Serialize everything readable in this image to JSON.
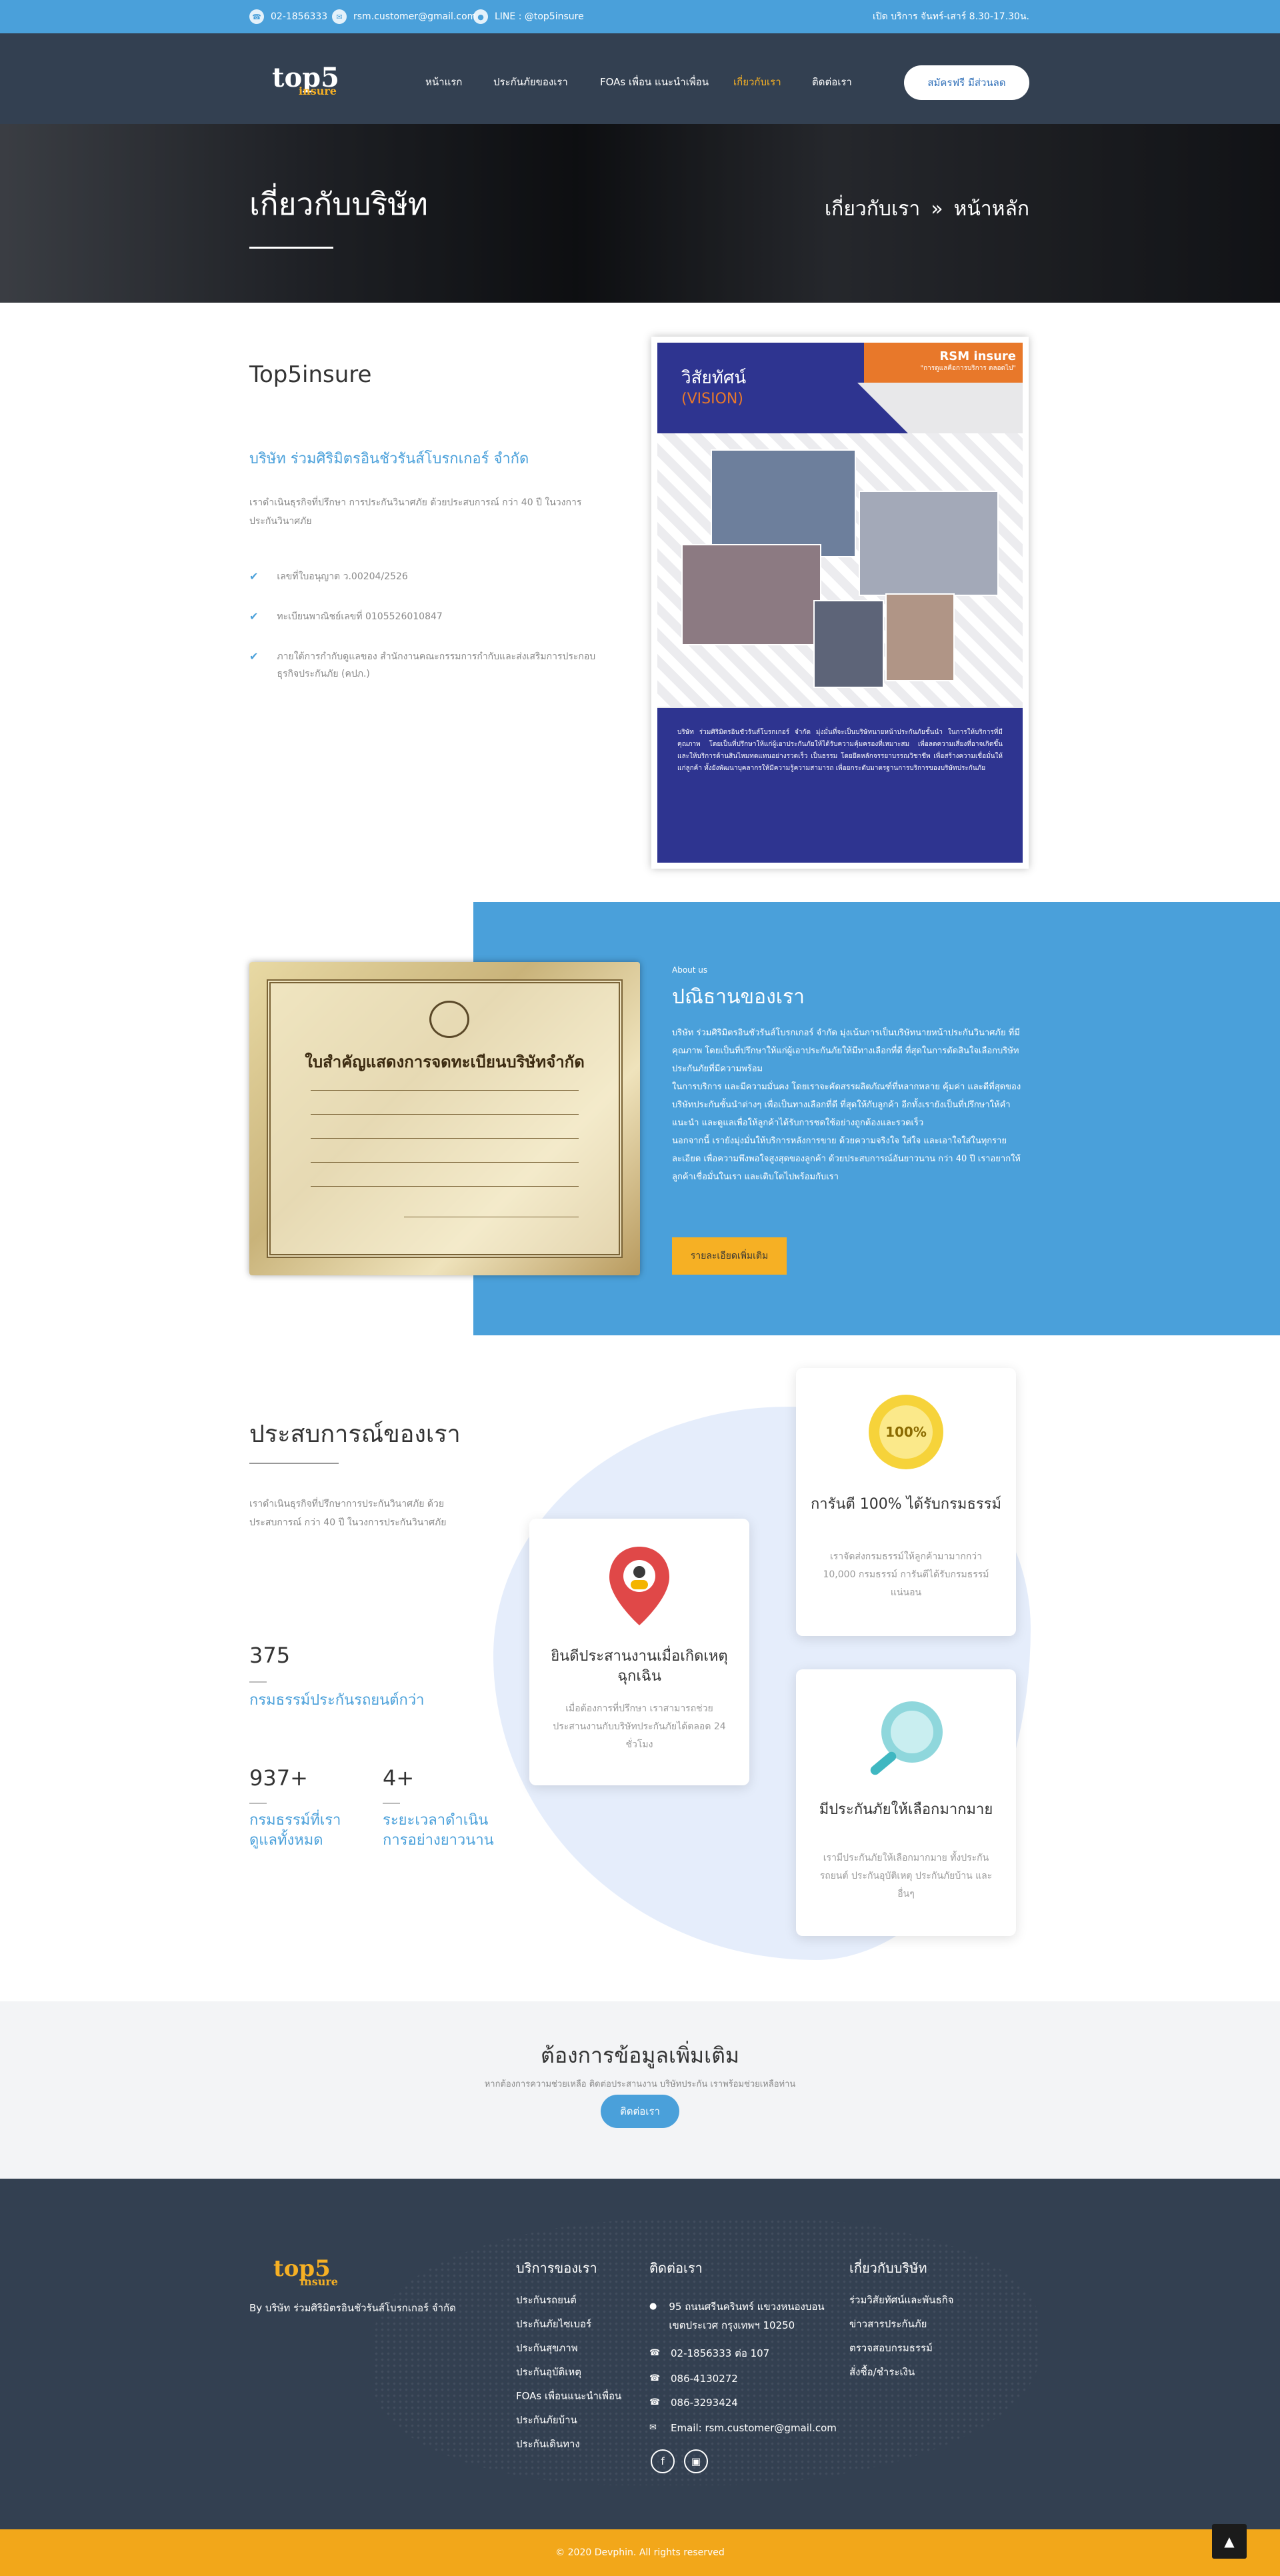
{
  "topbar": {
    "phone": "02-1856333",
    "email": "rsm.customer@gmail.com",
    "line": "LINE : @top5insure",
    "hours": "เปิด บริการ จันทร์-เสาร์ 8.30-17.30น."
  },
  "nav": {
    "logo_main": "top5",
    "logo_sub": "insure",
    "items": [
      "หน้าแรก",
      "ประกันภัยของเรา",
      "FOAs เพื่อน แนะนำเพื่อน",
      "เกี่ยวกับเรา",
      "ติดต่อเรา"
    ],
    "cta": "สมัครฟรี มีส่วนลด"
  },
  "hero": {
    "title": "เกี่ยวกับบริษัท",
    "crumb_current": "เกี่ยวกับเรา",
    "crumb_sep": "»",
    "crumb_home": "หน้าหลัก"
  },
  "intro": {
    "title": "Top5insure",
    "subtitle": "บริษัท ร่วมศิริมิตรอินชัวรันส์โบรกเกอร์ จำกัด",
    "desc": "เราดำเนินธุรกิจที่ปรึกษา การประกันวินาศภัย ด้วยประสบการณ์ กว่า 40 ปี ในวงการประกันวินาศภัย",
    "checks": [
      "เลขที่ใบอนุญาต ว.00204/2526",
      "ทะเบียนพาณิชย์เลขที่ 0105526010847",
      "ภายใต้การกำกับดูแลของ สำนักงานคณะกรรมการกำกับและส่งเสริมการประกอบธุรกิจประกันภัย (คปภ.)"
    ]
  },
  "vision": {
    "title": "วิสัยทัศน์",
    "title_en": "(VISION)",
    "brand": "RSM insure",
    "brand_tag": "\"การดูแลคือการบริการ ตลอดไป\"",
    "text": "บริษัท ร่วมศิริมิตรอินชัวรันส์โบรกเกอร์ จำกัด มุ่งมั่นที่จะเป็นบริษัทนายหน้าประกันภัยชั้นนำ ในการให้บริการที่มีคุณภาพ โดยเป็นที่ปรึกษาให้แก่ผู้เอาประกันภัยให้ได้รับความคุ้มครองที่เหมาะสม เพื่อลดความเสี่ยงที่อาจเกิดขึ้น และให้บริการด้านสินไหมทดแทนอย่างรวดเร็ว เป็นธรรม โดยยึดหลักจรรยาบรรณวิชาชีพ เพื่อสร้างความเชื่อมั่นให้แก่ลูกค้า ทั้งยังพัฒนาบุคลากรให้มีความรู้ความสามารถ เพื่อยกระดับมาตรฐานการบริการของบริษัทประกันภัย"
  },
  "about": {
    "cert_title": "ใบสำคัญแสดงการจดทะเบียนบริษัทจำกัด",
    "label": "About us",
    "title": "ปณิธานของเรา",
    "p1": "บริษัท ร่วมศิริมิตรอินชัวรันส์โบรกเกอร์ จำกัด มุ่งเน้นการเป็นบริษัทนายหน้าประกันวินาศภัย ที่มีคุณภาพ โดยเป็นที่ปรึกษาให้แก่ผู้เอาประกันภัยให้มีทางเลือกที่ดี ที่สุดในการตัดสินใจเลือกบริษัทประกันภัยที่มีความพร้อม",
    "p2": "ในการบริการ และมีความมั่นคง โดยเราจะคัดสรรผลิตภัณฑ์ที่หลากหลาย คุ้มค่า และดีที่สุดของบริษัทประกันชั้นนำต่างๆ เพื่อเป็นทางเลือกที่ดี ที่สุดให้กับลูกค้า อีกทั้งเรายังเป็นที่ปรึกษาให้คำแนะนำ และดูแลเพื่อให้ลูกค้าได้รับการชดใช้อย่างถูกต้องและรวดเร็ว",
    "p3": "นอกจากนี้ เรายังมุ่งมั่นให้บริการหลังการขาย ด้วยความจริงใจ ใส่ใจ และเอาใจใส่ในทุกรายละเอียด เพื่อความพึงพอใจสูงสุดของลูกค้า ด้วยประสบการณ์อันยาวนาน กว่า 40 ปี เราอยากให้ลูกค้าเชื่อมั่นในเรา และเติบโตไปพร้อมกับเรา",
    "button": "รายละเอียดเพิ่มเติม"
  },
  "experience": {
    "title": "ประสบการณ์ของเรา",
    "desc": "เราดำเนินธุรกิจที่ปรึกษาการประกันวินาศภัย ด้วยประสบการณ์ กว่า 40 ปี ในวงการประกันวินาศภัย",
    "stats": [
      {
        "num": "375",
        "label": "กรมธรรม์ประกันรถยนต์กว่า"
      },
      {
        "num": "937+",
        "label": "กรมธรรม์ที่เราดูแลทั้งหมด"
      },
      {
        "num": "4+",
        "label": "ระยะเวลาดำเนินการอย่างยาวนาน"
      }
    ],
    "cards": [
      {
        "title": "ยินดีประสานงานเมื่อเกิดเหตุฉุกเฉิน",
        "text": "เมื่อต้องการที่ปรึกษา เราสามารถช่วยประสานงานกับบริษัทประกันภัยได้ตลอด 24 ชั่วโมง"
      },
      {
        "title": "การันตี 100% ได้รับกรมธรรม์",
        "badge": "100%",
        "text": "เราจัดส่งกรมธรรม์ให้ลูกค้ามามากกว่า 10,000 กรมธรรม์ การันตีได้รับกรมธรรม์แน่นอน"
      },
      {
        "title": "มีประกันภัยให้เลือกมากมาย",
        "text": "เรามีประกันภัยให้เลือกมากมาย ทั้งประกันรถยนต์ ประกันอุบัติเหตุ ประกันภัยบ้าน และ อื่นๆ"
      }
    ]
  },
  "cta": {
    "title": "ต้องการข้อมูลเพิ่มเติม",
    "sub": "หากต้องการความช่วยเหลือ ติดต่อประสานงาน บริษัทประกัน เราพร้อมช่วยเหลือท่าน",
    "button": "ติดต่อเรา"
  },
  "footer": {
    "about": "By บริษัท ร่วมศิริมิตรอินชัวรันส์โบรกเกอร์ จำกัด",
    "services_title": "บริการของเรา",
    "services": [
      "ประกันรถยนต์",
      "ประกันภัยไซเบอร์",
      "ประกันสุขภาพ",
      "ประกันอุบัติเหตุ",
      "FOAs เพื่อนแนะนำเพื่อน",
      "ประกันภัยบ้าน",
      "ประกันเดินทาง"
    ],
    "contact_title": "ติดต่อเรา",
    "address": "95 ถนนศรีนครินทร์ แขวงหนองบอน เขตประเวศ กรุงเทพฯ 10250",
    "phone1": "02-1856333 ต่อ 107",
    "phone2": "086-4130272",
    "phone3": "086-3293424",
    "email": "Email: rsm.customer@gmail.com",
    "company_title": "เกี่ยวกับบริษัท",
    "company": [
      "ร่วมวิสัยทัศน์และพันธกิจ",
      "ข่าวสารประกันภัย",
      "ตรวจสอบกรมธรรม์",
      "สั่งซื้อ/ชำระเงิน"
    ],
    "copyright": "© 2020 Devphin. All rights reserved"
  }
}
